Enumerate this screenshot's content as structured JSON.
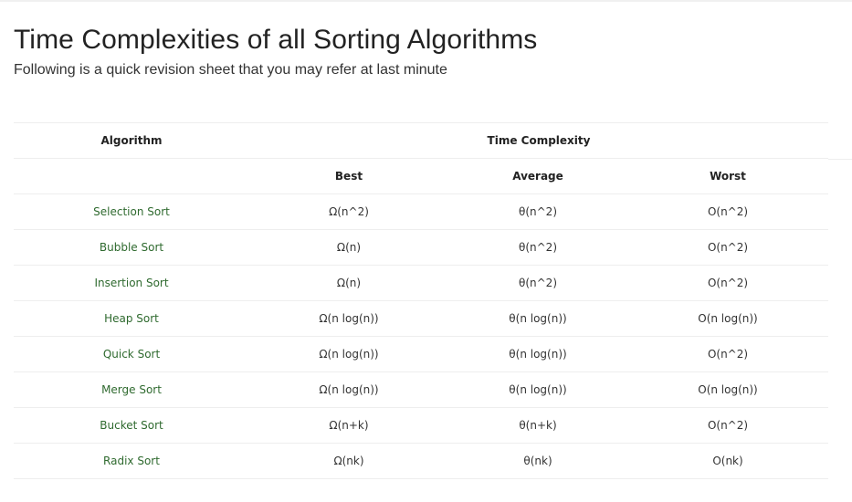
{
  "page": {
    "title": "Time Complexities of all Sorting Algorithms",
    "subtitle": "Following is a quick revision sheet that you may refer at last minute"
  },
  "table": {
    "header": {
      "algorithm": "Algorithm",
      "time_complexity": "Time Complexity",
      "best": "Best",
      "average": "Average",
      "worst": "Worst"
    },
    "rows": [
      {
        "name": "Selection Sort",
        "best": "Ω(n^2)",
        "average": "θ(n^2)",
        "worst": "O(n^2)"
      },
      {
        "name": "Bubble Sort",
        "best": "Ω(n)",
        "average": "θ(n^2)",
        "worst": "O(n^2)"
      },
      {
        "name": "Insertion Sort",
        "best": "Ω(n)",
        "average": "θ(n^2)",
        "worst": "O(n^2)"
      },
      {
        "name": "Heap Sort",
        "best": "Ω(n log(n))",
        "average": "θ(n log(n))",
        "worst": "O(n log(n))"
      },
      {
        "name": "Quick Sort",
        "best": "Ω(n log(n))",
        "average": "θ(n log(n))",
        "worst": "O(n^2)"
      },
      {
        "name": "Merge Sort",
        "best": "Ω(n log(n))",
        "average": "θ(n log(n))",
        "worst": "O(n log(n))"
      },
      {
        "name": "Bucket Sort",
        "best": "Ω(n+k)",
        "average": "θ(n+k)",
        "worst": "O(n^2)"
      },
      {
        "name": "Radix Sort",
        "best": "Ω(nk)",
        "average": "θ(nk)",
        "worst": "O(nk)"
      }
    ]
  },
  "colors": {
    "algorithm_link": "#2f6a2f",
    "divider": "#eeeeee",
    "text": "#222222"
  }
}
